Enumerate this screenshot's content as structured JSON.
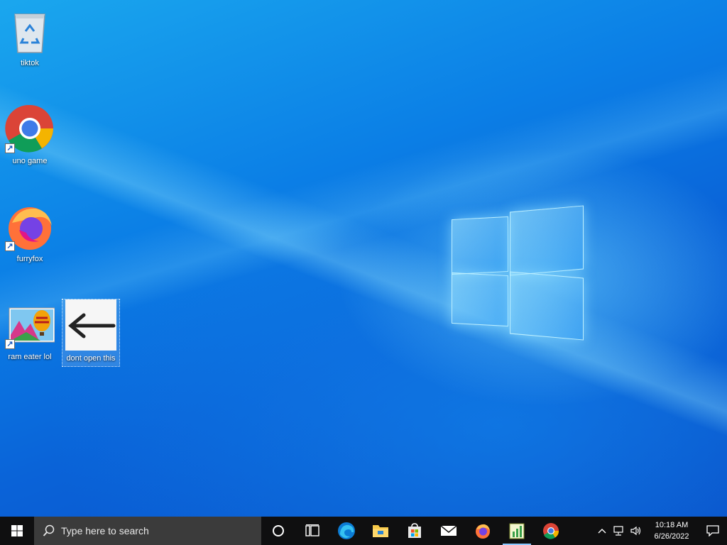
{
  "desktop": {
    "icons": [
      {
        "label": "tiktok",
        "icon": "recycle-bin-icon"
      },
      {
        "label": "uno game",
        "icon": "chrome-icon"
      },
      {
        "label": "furryfox",
        "icon": "firefox-icon"
      },
      {
        "label": "ram eater lol",
        "icon": "hot-air-balloon-picture-icon"
      },
      {
        "label": "dont open this",
        "icon": "left-arrow-image-icon"
      }
    ]
  },
  "taskbar": {
    "search_placeholder": "Type here to search",
    "pinned": [
      "cortana-icon",
      "task-view-icon",
      "edge-icon",
      "file-explorer-icon",
      "store-icon",
      "mail-icon",
      "firefox-icon",
      "spreadsheet-app-icon",
      "chrome-icon"
    ],
    "active_app": "spreadsheet-app-icon"
  },
  "tray": {
    "time": "10:18 AM",
    "date": "6/26/2022"
  },
  "colors": {
    "taskbar_bg": "#0f0f10",
    "search_bg": "#3b3b3b",
    "accent": "#0a63d8"
  }
}
